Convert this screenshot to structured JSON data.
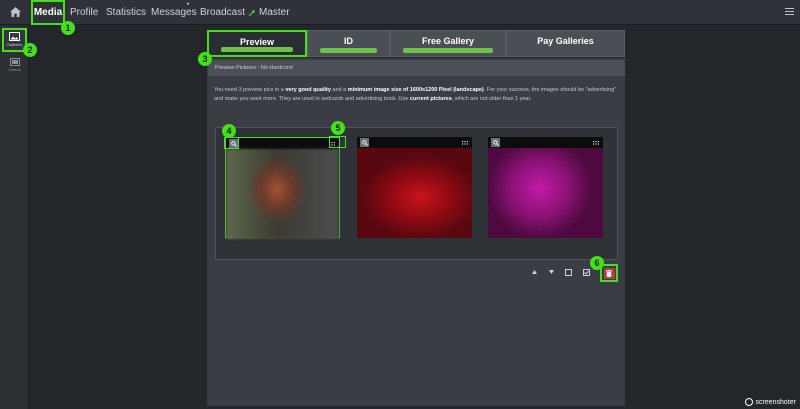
{
  "nav": {
    "media": "Media",
    "profile": "Profile",
    "statistics": "Statistics",
    "messages": "Messages",
    "messages_dot": "•",
    "broadcast": "Broadcast",
    "master": "Master"
  },
  "sidebar": {
    "galleries": "Galleries",
    "videos": "Videos"
  },
  "tabs": {
    "preview": "Preview",
    "id": "ID",
    "free_gallery": "Free Gallery",
    "pay_galleries": "Pay Galleries"
  },
  "panel": {
    "header": "Preview Pictures - No Hardcore!",
    "intro_1": "You need 3 preview pics in a ",
    "intro_b1": "very good quality",
    "intro_2": " and a ",
    "intro_b2": "minimum image size of 1600x1200 Pixel (landscape)",
    "intro_3": ". For your success, the images should be \"advertising\" and make you want more. They are used in sedcards and advertising tools. Use ",
    "intro_b3": "current pictures",
    "intro_4": ", which are not older than 1 year."
  },
  "badges": [
    "1",
    "2",
    "3",
    "4",
    "5",
    "6"
  ],
  "watermark": "screenshoter",
  "colors": {
    "highlight": "#45e01c",
    "tab_bar": "#6dc24c",
    "delete": "#b04040"
  }
}
